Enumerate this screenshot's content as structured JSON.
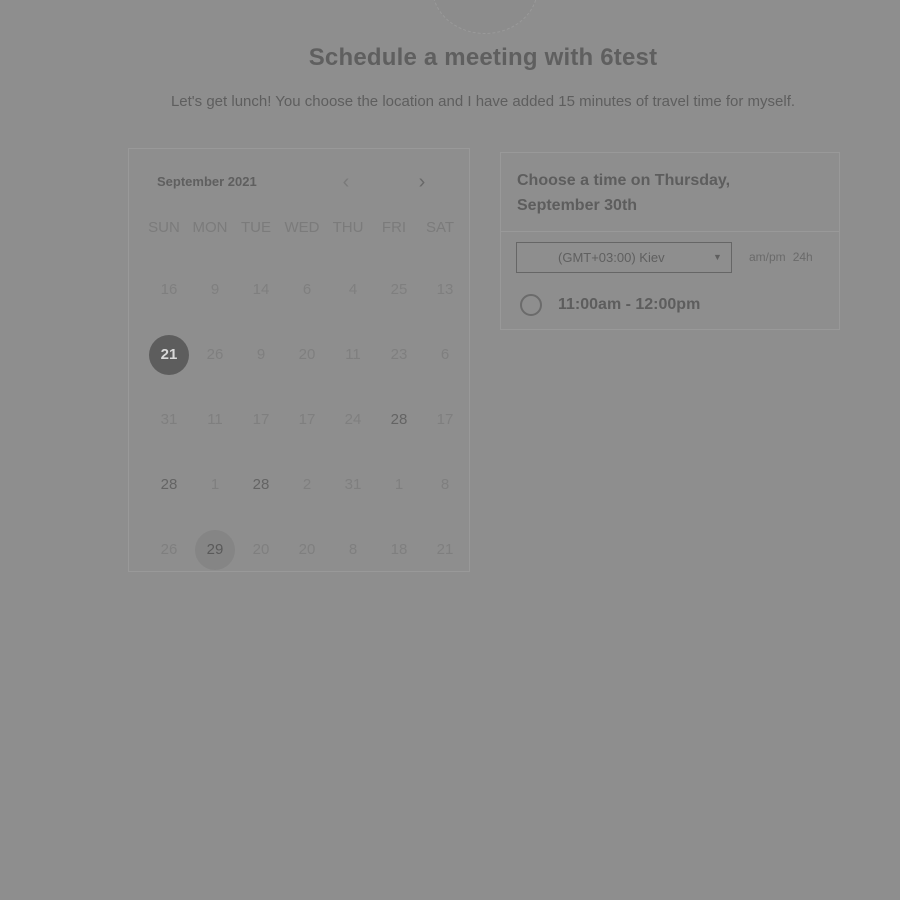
{
  "header": {
    "title": "Schedule a meeting with 6test",
    "subtitle": "Let's get lunch! You choose the location and I have added 15 minutes of travel time for myself."
  },
  "calendar": {
    "month_label": "September 2021",
    "prev_icon": "‹",
    "next_icon": "›",
    "weekdays": [
      "SUN",
      "MON",
      "TUE",
      "WED",
      "THU",
      "FRI",
      "SAT"
    ],
    "weeks": [
      [
        "16",
        "9",
        "14",
        "6",
        "4",
        "25",
        "13"
      ],
      [
        "21",
        "26",
        "9",
        "20",
        "11",
        "23",
        "6"
      ],
      [
        "31",
        "11",
        "17",
        "17",
        "24",
        "28",
        "17"
      ],
      [
        "28",
        "1",
        "28",
        "2",
        "31",
        "1",
        "8"
      ],
      [
        "26",
        "29",
        "20",
        "20",
        "8",
        "18",
        "21"
      ]
    ]
  },
  "time_panel": {
    "heading": "Choose a time on Thursday, September 30th",
    "timezone": "(GMT+03:00) Kiev",
    "timezone_caret": "▼",
    "format_ampm": "am/pm",
    "format_24h": "24h",
    "slots": [
      "11:00am - 12:00pm"
    ]
  }
}
